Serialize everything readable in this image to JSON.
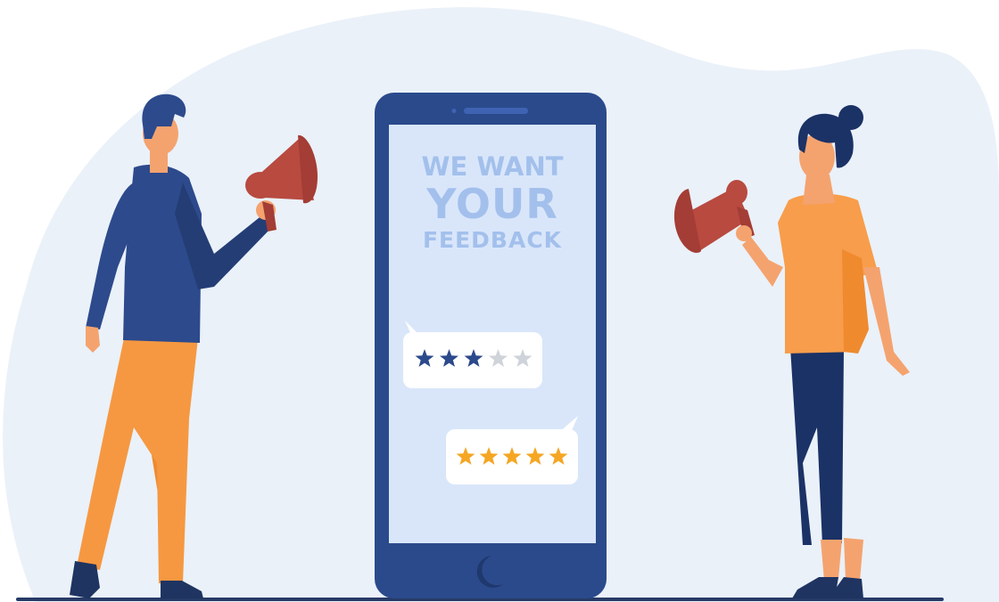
{
  "screen": {
    "headline_line1": "WE WANT",
    "headline_line2": "YOUR",
    "headline_line3": "FEEDBACK"
  },
  "ratings": [
    {
      "rating": 3,
      "out_of": 5
    },
    {
      "rating": 5,
      "out_of": 5
    }
  ],
  "colors": {
    "background_blob": "#eaf1f9",
    "phone_body": "#2b4a8c",
    "phone_screen": "#d9e6fa",
    "headline_text": "#a3c0ec",
    "star_dark": "#2b4a8c",
    "star_gold": "#f5a623",
    "star_empty": "#cfd3da",
    "shirt_blue": "#2d4a8c",
    "pants_orange": "#f69841",
    "top_orange": "#f89d4b",
    "megaphone": "#b84a40"
  },
  "icons": [
    "megaphone-icon",
    "star-icon",
    "home-button-icon"
  ]
}
